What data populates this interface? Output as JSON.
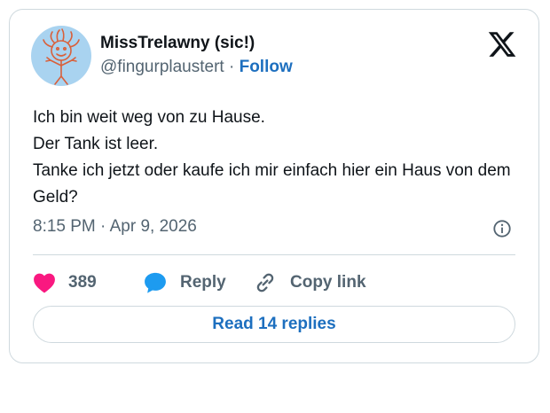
{
  "author": {
    "display_name": "MissTrelawny (sic!)",
    "handle": "@fingurplaustert",
    "separator": "·",
    "follow_label": "Follow"
  },
  "tweet": {
    "lines": [
      "Ich bin weit weg von zu Hause.",
      "Der Tank ist leer.",
      "Tanke ich jetzt oder kaufe ich mir einfach hier ein Haus von dem Geld?"
    ],
    "timestamp": "8:15 PM · Apr 9, 2026"
  },
  "actions": {
    "like_count": "389",
    "reply_label": "Reply",
    "copy_link_label": "Copy link"
  },
  "read_replies_label": "Read 14 replies",
  "colors": {
    "accent": "#1d6fbf",
    "like": "#f91880",
    "reply_icon": "#1d9bf0",
    "avatar_bg": "#a9d3f0",
    "avatar_drawing": "#d9603b"
  },
  "icons": {
    "brand": "x-logo-icon",
    "info": "info-icon",
    "like": "heart-icon",
    "reply": "speech-bubble-icon",
    "copy_link": "link-icon"
  }
}
